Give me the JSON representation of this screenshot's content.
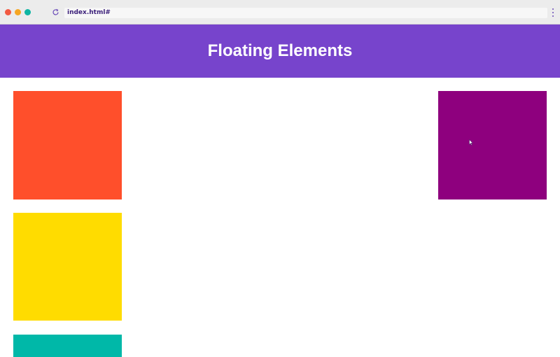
{
  "browser": {
    "url": "index.html#",
    "traffic_lights": {
      "close_color": "#f25a42",
      "minimize_color": "#f5a623",
      "maximize_color": "#0fb5a3"
    },
    "reload_icon": "reload-icon",
    "menu_icon": "kebab-menu-icon"
  },
  "header": {
    "title": "Floating Elements",
    "background": "#7744cc"
  },
  "boxes": [
    {
      "color": "#ff4f2b"
    },
    {
      "color": "#8e007e"
    },
    {
      "color": "#ffdc00"
    },
    {
      "color": "#00b8a8"
    }
  ]
}
